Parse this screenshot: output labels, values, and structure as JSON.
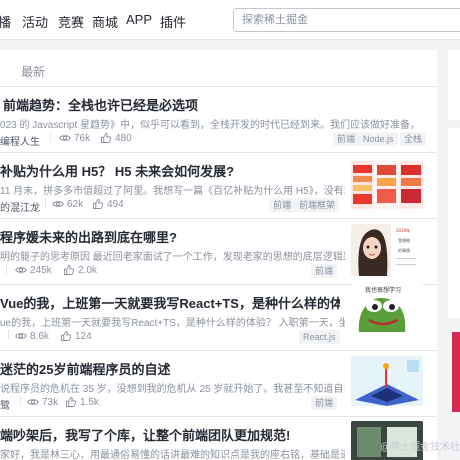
{
  "nav": {
    "items": [
      "播",
      "活动",
      "竞赛",
      "商城",
      "APP",
      "插件"
    ]
  },
  "search": {
    "placeholder": "探索稀土掘金"
  },
  "tabs": {
    "latest": "最新"
  },
  "articles": [
    {
      "title": "前端趋势：全栈也许已经是必选项",
      "excerpt": "023 的 Javascript 星趋势》中，似乎可以看到，全栈开发的时代已经到来。我们应该做好准备，欢迎其到来。",
      "author": "编程人生",
      "views": "76k",
      "likes": "480",
      "tags": [
        "前端",
        "Node.js",
        "全栈"
      ]
    },
    {
      "title": "补贴为什么用 H5？ H5 未来会如何发展?",
      "excerpt": "11 月末，拼多多市值超过了阿里。我想写一篇《百亿补贴为什么用 H5》，没有动笔；",
      "author": "的混江龙",
      "views": "62k",
      "likes": "494",
      "tags": [
        "前端",
        "前端框架"
      ]
    },
    {
      "title": "程序媛未来的出路到底在哪里?",
      "excerpt": "明的躯子的思考原因 最近回老家面试了一个工作，发现老家的思想的底层逻辑是：到...",
      "author": "",
      "views": "245k",
      "likes": "2.0k",
      "tags": [
        "前端"
      ]
    },
    {
      "title": "Vue的我，上班第一天就要我写React+TS，是种什么样的体验?",
      "excerpt": "ue的我，上班第一天就要我写React+TS，是种什么样的体验？ 入职第一天，坐公交来...",
      "author": "",
      "views": "8.6k",
      "likes": "124",
      "tags": [
        "React.js"
      ]
    },
    {
      "title": "迷茫的25岁前端程序员的自述",
      "excerpt": "说程序员的危机在 35 岁，没想到我的危机从 25 岁就开始了。我甚至不知道自己是不...",
      "author": "鹭",
      "views": "73k",
      "likes": "1.5k",
      "tags": [
        "前端"
      ]
    },
    {
      "title": "端吵架后，我写了个库，让整个前端团队更加规范!",
      "excerpt": "家好，我是林三心，用最通俗易懂的话讲最难的知识点是我的座右铭，基础是进阶的...",
      "author": "",
      "views": "",
      "likes": "",
      "tags": []
    }
  ],
  "watermark": "@稀土掘金技术社区",
  "thumb_texts": {
    "t3": [
      "2019年",
      "我想做",
      "的事情"
    ],
    "t4": "我也很想学习"
  },
  "colors": {
    "accent": "#1e80ff",
    "text": "#252933",
    "muted": "#8a919f"
  }
}
